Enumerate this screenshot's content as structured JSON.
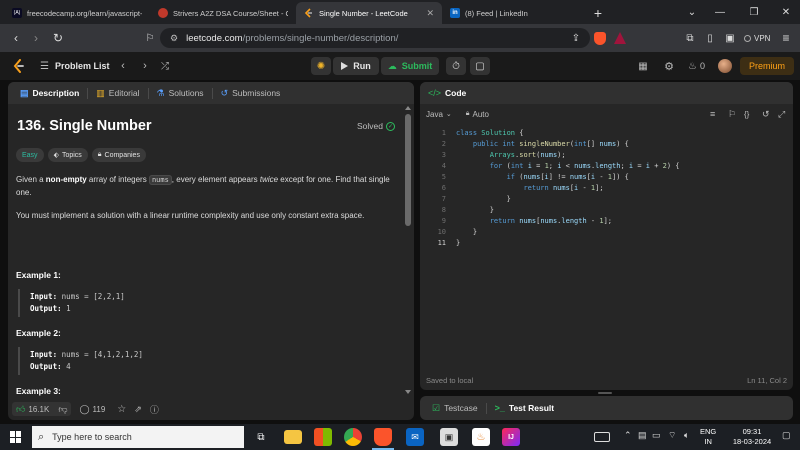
{
  "browser": {
    "tabs": [
      {
        "title": "freecodecamp.org/learn/javascript-a",
        "favicon_color": "#0a0a23",
        "favicon_text": "(A)"
      },
      {
        "title": "Strivers A2Z DSA Course/Sheet - Cra",
        "favicon_color": "#c0392b",
        "favicon_text": "TUF"
      },
      {
        "title": "Single Number - LeetCode",
        "favicon_color": "#f89f1b",
        "favicon_text": ""
      },
      {
        "title": "(8) Feed | LinkedIn",
        "favicon_color": "#0a66c2",
        "favicon_text": "in"
      }
    ],
    "url_host": "leetcode.com",
    "url_path": "/problems/single-number/description/",
    "vpn_label": "VPN"
  },
  "lc_header": {
    "problem_list": "Problem List",
    "run": "Run",
    "submit": "Submit",
    "streak": "0",
    "premium": "Premium"
  },
  "left_tabs": [
    "Description",
    "Editorial",
    "Solutions",
    "Submissions"
  ],
  "problem": {
    "title": "136. Single Number",
    "status": "Solved",
    "difficulty": "Easy",
    "topics": "Topics",
    "companies": "Companies",
    "para1_a": "Given a ",
    "para1_b": "non-empty",
    "para1_c": " array of integers ",
    "para1_code": "nums",
    "para1_d": ", every element appears ",
    "para1_e": "twice",
    "para1_f": " except for one. Find that single one.",
    "para2": "You must implement a solution with a linear runtime complexity and use only constant extra space.",
    "examples": [
      {
        "heading": "Example 1:",
        "input_label": "Input:",
        "input": "nums = [2,2,1]",
        "output_label": "Output:",
        "output": "1"
      },
      {
        "heading": "Example 2:",
        "input_label": "Input:",
        "input": "nums = [4,1,2,1,2]",
        "output_label": "Output:",
        "output": "4"
      },
      {
        "heading": "Example 3:"
      }
    ],
    "likes": "16.1K",
    "comments": "119"
  },
  "code_panel": {
    "title": "Code",
    "language": "Java",
    "mode": "Auto",
    "saved": "Saved to local",
    "cursor": "Ln 11, Col 2",
    "line_numbers": [
      "1",
      "2",
      "3",
      "4",
      "5",
      "6",
      "7",
      "8",
      "9",
      "10",
      "11"
    ]
  },
  "bottom_panel": {
    "testcase": "Testcase",
    "test_result": "Test Result"
  },
  "taskbar": {
    "search_placeholder": "Type here to search",
    "lang_top": "ENG",
    "lang_bottom": "IN",
    "time": "09:31",
    "date": "18-03-2024"
  }
}
